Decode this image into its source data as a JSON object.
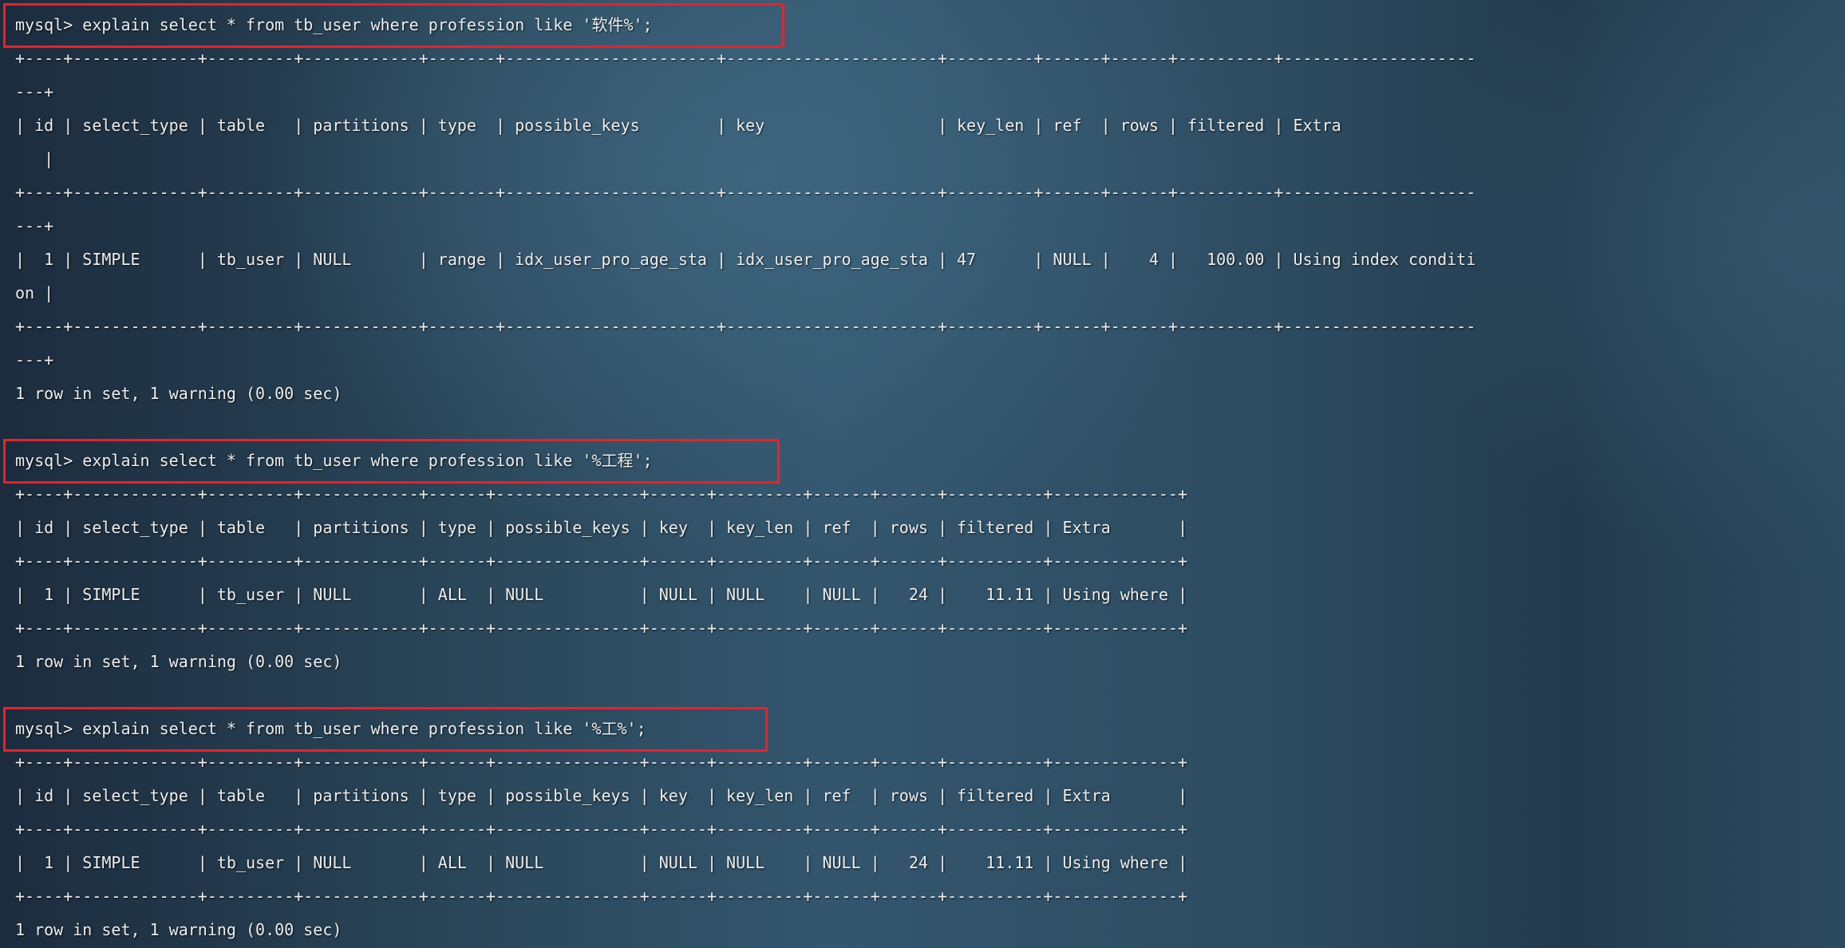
{
  "highlight_color": "#e8222a",
  "blocks": [
    {
      "prompt": "mysql> explain select * from tb_user where profession like '软件%';",
      "lines": [
        "+----+-------------+---------+------------+-------+----------------------+----------------------+---------+------+------+----------+--------------------",
        "---+",
        "| id | select_type | table   | partitions | type  | possible_keys        | key                  | key_len | ref  | rows | filtered | Extra",
        "   |",
        "+----+-------------+---------+------------+-------+----------------------+----------------------+---------+------+------+----------+--------------------",
        "---+",
        "|  1 | SIMPLE      | tb_user | NULL       | range | idx_user_pro_age_sta | idx_user_pro_age_sta | 47      | NULL |    4 |   100.00 | Using index conditi",
        "on |",
        "+----+-------------+---------+------------+-------+----------------------+----------------------+---------+------+------+----------+--------------------",
        "---+"
      ],
      "status": "1 row in set, 1 warning (0.00 sec)"
    },
    {
      "prompt": "mysql> explain select * from tb_user where profession like '%工程';",
      "lines": [
        "+----+-------------+---------+------------+------+---------------+------+---------+------+------+----------+-------------+",
        "| id | select_type | table   | partitions | type | possible_keys | key  | key_len | ref  | rows | filtered | Extra       |",
        "+----+-------------+---------+------------+------+---------------+------+---------+------+------+----------+-------------+",
        "|  1 | SIMPLE      | tb_user | NULL       | ALL  | NULL          | NULL | NULL    | NULL |   24 |    11.11 | Using where |",
        "+----+-------------+---------+------------+------+---------------+------+---------+------+------+----------+-------------+"
      ],
      "status": "1 row in set, 1 warning (0.00 sec)"
    },
    {
      "prompt": "mysql> explain select * from tb_user where profession like '%工%';",
      "lines": [
        "+----+-------------+---------+------------+------+---------------+------+---------+------+------+----------+-------------+",
        "| id | select_type | table   | partitions | type | possible_keys | key  | key_len | ref  | rows | filtered | Extra       |",
        "+----+-------------+---------+------------+------+---------------+------+---------+------+------+----------+-------------+",
        "|  1 | SIMPLE      | tb_user | NULL       | ALL  | NULL          | NULL | NULL    | NULL |   24 |    11.11 | Using where |",
        "+----+-------------+---------+------------+------+---------------+------+---------+------+------+----------+-------------+"
      ],
      "status": "1 row in set, 1 warning (0.00 sec)"
    }
  ]
}
